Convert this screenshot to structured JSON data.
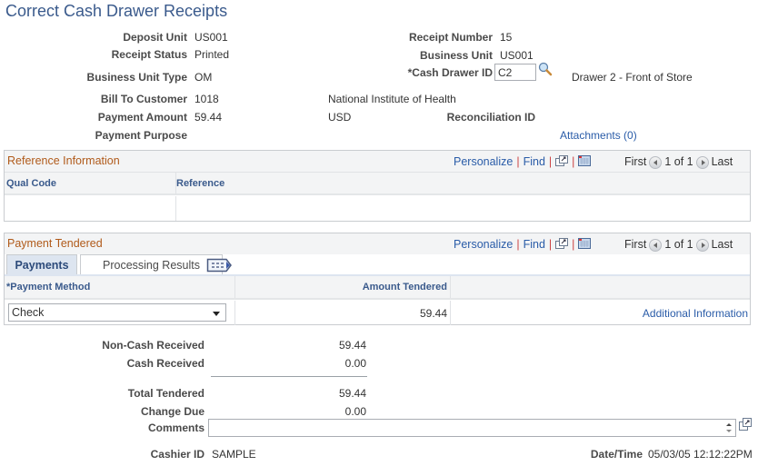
{
  "page_title": "Correct Cash Drawer Receipts",
  "header": {
    "deposit_unit_label": "Deposit Unit",
    "deposit_unit_value": "US001",
    "receipt_status_label": "Receipt Status",
    "receipt_status_value": "Printed",
    "business_unit_type_label": "Business Unit Type",
    "business_unit_type_value": "OM",
    "bill_to_customer_label": "Bill To Customer",
    "bill_to_customer_value": "1018",
    "customer_name": "National Institute of Health",
    "payment_amount_label": "Payment Amount",
    "payment_amount_value": "59.44",
    "currency": "USD",
    "payment_purpose_label": "Payment Purpose",
    "receipt_number_label": "Receipt Number",
    "receipt_number_value": "15",
    "business_unit_label": "Business Unit",
    "business_unit_value": "US001",
    "cash_drawer_id_label": "*Cash Drawer ID",
    "cash_drawer_id_value": "C2",
    "cash_drawer_description": "Drawer 2 - Front of Store",
    "reconciliation_id_label": "Reconciliation ID",
    "attachments_link": "Attachments (0)"
  },
  "reference_grid": {
    "title": "Reference Information",
    "personalize": "Personalize",
    "find": "Find",
    "first": "First",
    "count": "1 of 1",
    "last": "Last",
    "columns": [
      "Qual Code",
      "Reference"
    ],
    "rows": [
      [
        "",
        ""
      ]
    ]
  },
  "payment_grid": {
    "title": "Payment Tendered",
    "personalize": "Personalize",
    "find": "Find",
    "first": "First",
    "count": "1 of 1",
    "last": "Last",
    "tabs": [
      {
        "label": "Payments",
        "active": true
      },
      {
        "label": "Processing Results",
        "active": false
      }
    ],
    "columns": [
      "*Payment Method",
      "Amount Tendered",
      ""
    ],
    "rows": [
      {
        "payment_method": "Check",
        "amount_tendered": "59.44",
        "link": "Additional Information"
      }
    ]
  },
  "totals": {
    "non_cash_received_label": "Non-Cash Received",
    "non_cash_received_value": "59.44",
    "cash_received_label": "Cash Received",
    "cash_received_value": "0.00",
    "total_tendered_label": "Total Tendered",
    "total_tendered_value": "59.44",
    "change_due_label": "Change Due",
    "change_due_value": "0.00",
    "comments_label": "Comments",
    "comments_value": ""
  },
  "footer": {
    "cashier_id_label": "Cashier ID",
    "cashier_id_value": "SAMPLE",
    "datetime_label": "Date/Time",
    "datetime_value": "05/03/05 12:12:22PM"
  }
}
